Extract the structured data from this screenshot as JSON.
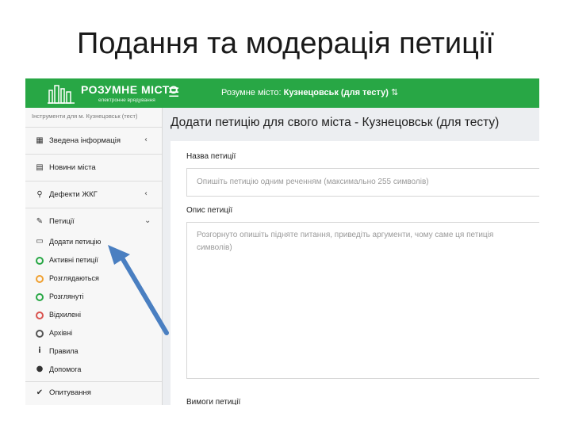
{
  "slide": {
    "title": "Подання та модерація петиції"
  },
  "header": {
    "logo_title": "РОЗУМНЕ МІСТО",
    "logo_subtitle": "електронне врядування",
    "menu_icon": "hamburger-icon",
    "city_prefix": "Розумне місто: ",
    "city_name": "Кузнецовськ (для тесту)",
    "switch_icon": "swap-arrows-icon"
  },
  "sidebar": {
    "header": "Інструменти для м. Кузнецовськ (тест)",
    "items": [
      {
        "label": "Зведена інформація",
        "icon": "dashboard-icon",
        "has_arrow": true
      },
      {
        "label": "Новини міста",
        "icon": "news-icon",
        "has_arrow": false
      },
      {
        "label": "Дефекти ЖКГ",
        "icon": "search-icon",
        "has_arrow": true
      },
      {
        "label": "Петиції",
        "icon": "petition-icon",
        "has_arrow": true
      }
    ],
    "petition_subitems": [
      {
        "label": "Додати петицію",
        "icon": "add-form-icon",
        "ring_color": ""
      },
      {
        "label": "Активні петиції",
        "icon": "circle-icon",
        "ring_color": "#28a745"
      },
      {
        "label": "Розглядаються",
        "icon": "circle-icon",
        "ring_color": "#f0a030"
      },
      {
        "label": "Розглянуті",
        "icon": "circle-icon",
        "ring_color": "#28a745"
      },
      {
        "label": "Відхилені",
        "icon": "circle-icon",
        "ring_color": "#d9534f"
      },
      {
        "label": "Архівні",
        "icon": "circle-icon",
        "ring_color": "#555555"
      },
      {
        "label": "Правила",
        "icon": "info-icon",
        "ring_color": ""
      },
      {
        "label": "Допомога",
        "icon": "help-icon",
        "ring_color": ""
      }
    ],
    "survey": {
      "label": "Опитування",
      "icon": "check-icon"
    }
  },
  "main": {
    "heading": "Додати петицію для свого міста - Кузнецовськ (для тесту)",
    "name_label": "Назва петиції",
    "name_placeholder": "Опишіть петицію одним реченням (максимально 255 символів)",
    "desc_label": "Опис петиції",
    "desc_placeholder_line1": "Розгорнуто опишіть підняте питання, приведіть аргументи, чому саме ця петиція",
    "desc_placeholder_line2": "символів)",
    "next_label": "Вимоги петиції"
  },
  "annotation": {
    "arrow_color": "#4a7fc1",
    "arrow_icon": "pointer-arrow"
  }
}
